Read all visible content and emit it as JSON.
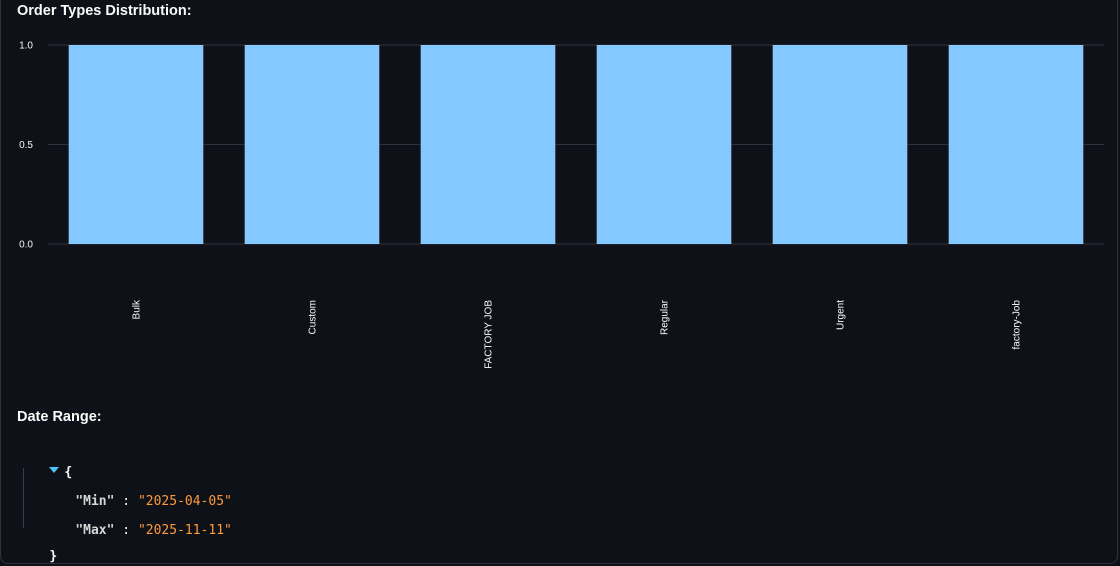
{
  "chart_section": {
    "heading": "Order Types Distribution:"
  },
  "chart_data": {
    "type": "bar",
    "title": "",
    "xlabel": "",
    "ylabel": "",
    "categories": [
      "Bulk",
      "Custom",
      "FACTORY JOB",
      "Regular",
      "Urgent",
      "factory-Job"
    ],
    "values": [
      1,
      1,
      1,
      1,
      1,
      1
    ],
    "ylim": [
      0,
      1
    ],
    "yticks": [
      "0.0",
      "0.5",
      "1.0"
    ],
    "grid": true,
    "bar_color": "#83c9ff",
    "grid_color": "#31333f"
  },
  "date_section": {
    "heading": "Date Range:",
    "json": {
      "open_brace": "{",
      "close_brace": "}",
      "entries": [
        {
          "key": "\"Min\"",
          "value": "\"2025-04-05\""
        },
        {
          "key": "\"Max\"",
          "value": "\"2025-11-11\""
        }
      ]
    },
    "colors": {
      "string_value": "#ff9a3c",
      "caret": "#4fc3f7"
    }
  }
}
